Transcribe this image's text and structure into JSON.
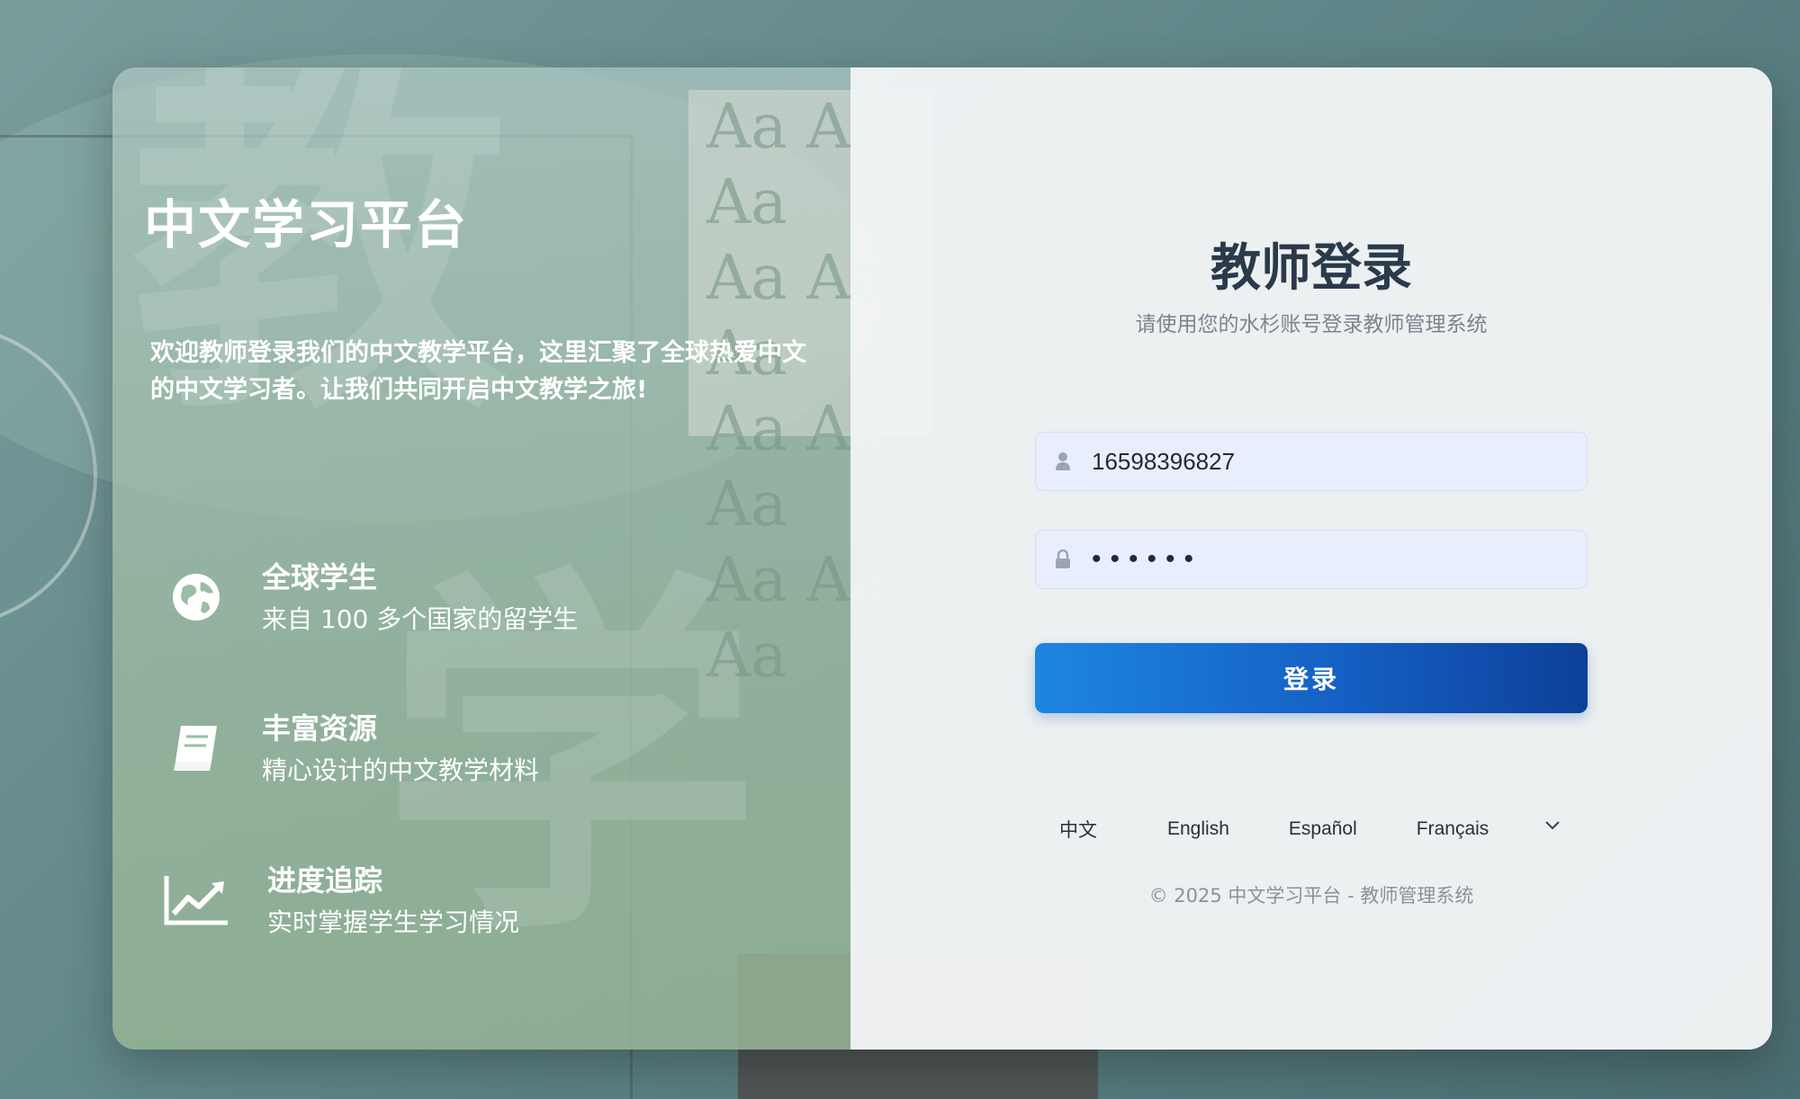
{
  "brand": {
    "title": "中文学习平台"
  },
  "welcome_text": "欢迎教师登录我们的中文教学平台，这里汇聚了全球热爱中文的中文学习者。让我们共同开启中文教学之旅!",
  "features": [
    {
      "icon": "globe-icon",
      "title": "全球学生",
      "desc": "来自 100 多个国家的留学生"
    },
    {
      "icon": "book-icon",
      "title": "丰富资源",
      "desc": "精心设计的中文教学材料"
    },
    {
      "icon": "chart-line-icon",
      "title": "进度追踪",
      "desc": "实时掌握学生学习情况"
    }
  ],
  "login": {
    "title": "教师登录",
    "subtitle": "请使用您的水杉账号登录教师管理系统",
    "username_value": "16598396827",
    "password_value": "••••••",
    "submit_label": "登录"
  },
  "languages": [
    "中文",
    "English",
    "Español",
    "Français"
  ],
  "footer": {
    "copyright": "© 2025 中文学习平台 - 教师管理系统"
  },
  "colors": {
    "primary_start": "#1d86e0",
    "primary_end": "#0d409a",
    "input_bg": "#e8effc",
    "title_text": "#2b3a4a"
  }
}
